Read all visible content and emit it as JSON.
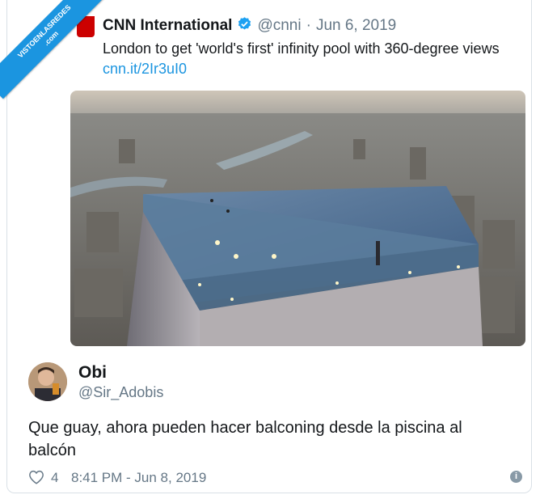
{
  "watermark": {
    "line1": "VISTOENLASREDES",
    "line2": ".com"
  },
  "quoted_tweet": {
    "name": "CNN International",
    "handle": "@cnni",
    "separator": "·",
    "date": "Jun 6, 2019",
    "text": "London to get 'world's first' infinity pool with 360-degree views",
    "link": "cnn.it/2Ir3uI0",
    "image_icon": "photo-rooftop-infinity-pool"
  },
  "tweet": {
    "name": "Obi",
    "handle": "@Sir_Adobis",
    "text": "Que guay, ahora pueden hacer balconing desde la piscina al balcón",
    "likes": "4",
    "timestamp": "8:41 PM - Jun 8, 2019"
  },
  "icons": {
    "verified": "verified-badge-icon",
    "bird": "twitter-bird-icon",
    "heart": "heart-icon",
    "info": "info-icon"
  },
  "colors": {
    "brand_blue": "#1b95e0",
    "cnn_red": "#cc0000",
    "muted": "#657786"
  }
}
